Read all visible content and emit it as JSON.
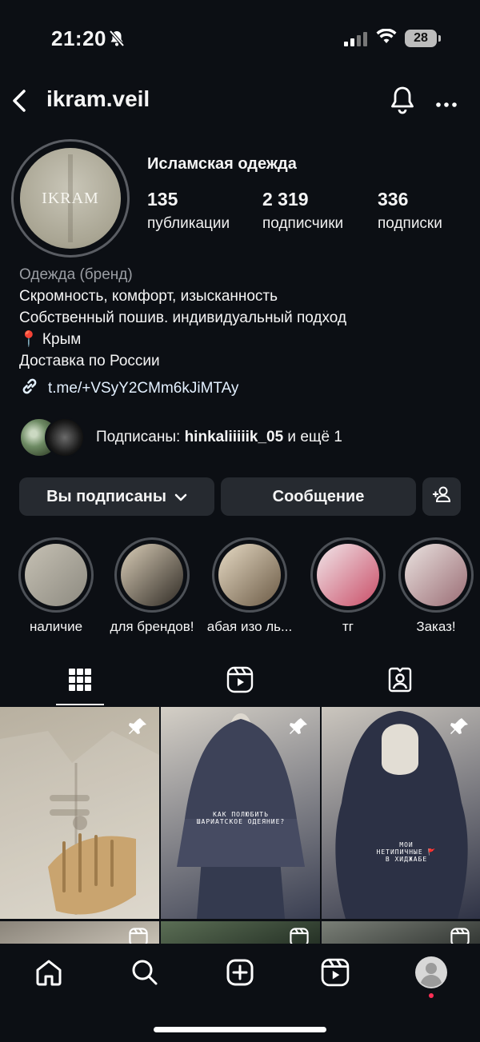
{
  "status_bar": {
    "time": "21:20",
    "battery": "28"
  },
  "header": {
    "username": "ikram.veil"
  },
  "profile": {
    "avatar_text": "IKRAM",
    "name": "Исламская одежда",
    "stats": [
      {
        "value": "135",
        "label": "публикации"
      },
      {
        "value": "2 319",
        "label": "подписчики"
      },
      {
        "value": "336",
        "label": "подписки"
      }
    ],
    "bio": {
      "category": "Одежда (бренд)",
      "lines": [
        "Скромность, комфорт, изысканность",
        "Собственный пошив. индивидуальный подход",
        "📍 Крым",
        "Доставка по России"
      ],
      "link": "t.me/+VSyY2CMm6kJiMTAy"
    },
    "followed_by": {
      "prefix": "Подписаны: ",
      "user": "hinkaliiiiik_05",
      "suffix": " и ещё 1"
    }
  },
  "buttons": {
    "following": "Вы подписаны",
    "message": "Сообщение"
  },
  "highlights": [
    {
      "label": "наличие",
      "colors": [
        "#8d8a80",
        "#c6c1b4"
      ]
    },
    {
      "label": "для брендов!",
      "colors": [
        "#2f2a24",
        "#d9cdb7"
      ]
    },
    {
      "label": "абая изо ль...",
      "colors": [
        "#6b5a45",
        "#e6dac4"
      ]
    },
    {
      "label": "тг",
      "colors": [
        "#c94d67",
        "#f1e7ea"
      ]
    },
    {
      "label": "Заказ!",
      "colors": [
        "#9a6c74",
        "#eae3e0"
      ]
    }
  ],
  "posts": [
    {
      "type": "pinned",
      "caption": "",
      "colors": [
        "#d9d3c6",
        "#b8b0a0"
      ]
    },
    {
      "type": "pinned",
      "caption": "КАК ПОЛЮБИТЬ ШАРИАТСКОЕ ОДЕЯНИЕ?",
      "colors": [
        "#3a3f52",
        "#d4cfc6"
      ]
    },
    {
      "type": "pinned",
      "caption": "МОИ НЕТИПИЧНЫЕ 🚩 В ХИДЖАБЕ",
      "colors": [
        "#2f3346",
        "#cbc6be"
      ]
    },
    {
      "type": "reel",
      "caption": "",
      "colors": [
        "#cfc8bb",
        "#8a847a"
      ]
    },
    {
      "type": "reel",
      "caption": "",
      "colors": [
        "#1f2a20",
        "#5b6e55"
      ]
    },
    {
      "type": "reel",
      "caption": "",
      "colors": [
        "#2b2f2c",
        "#7a7f77"
      ]
    }
  ]
}
